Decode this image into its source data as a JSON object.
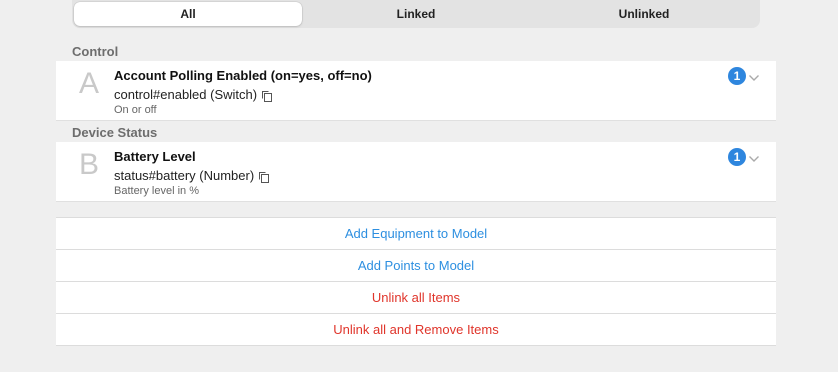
{
  "tabs": {
    "all": "All",
    "linked": "Linked",
    "unlinked": "Unlinked",
    "selected": "All"
  },
  "groups": [
    {
      "header": "Control",
      "item": {
        "letter": "A",
        "title": "Account Polling Enabled (on=yes, off=no)",
        "channel": "control#enabled (Switch)",
        "description": "On or off",
        "link_count": "1"
      }
    },
    {
      "header": "Device Status",
      "item": {
        "letter": "B",
        "title": "Battery Level",
        "channel": "status#battery (Number)",
        "description": "Battery level in %",
        "link_count": "1"
      }
    }
  ],
  "actions": {
    "add_equipment": "Add Equipment to Model",
    "add_points": "Add Points to Model",
    "unlink_all": "Unlink all Items",
    "unlink_remove": "Unlink all and Remove Items"
  },
  "colors": {
    "accent_blue": "#2e86de",
    "link_blue": "#2d8fe0",
    "danger_red": "#e0352b"
  },
  "icons": {
    "copy": "copy-icon",
    "chevron": "chevron-down-icon"
  }
}
